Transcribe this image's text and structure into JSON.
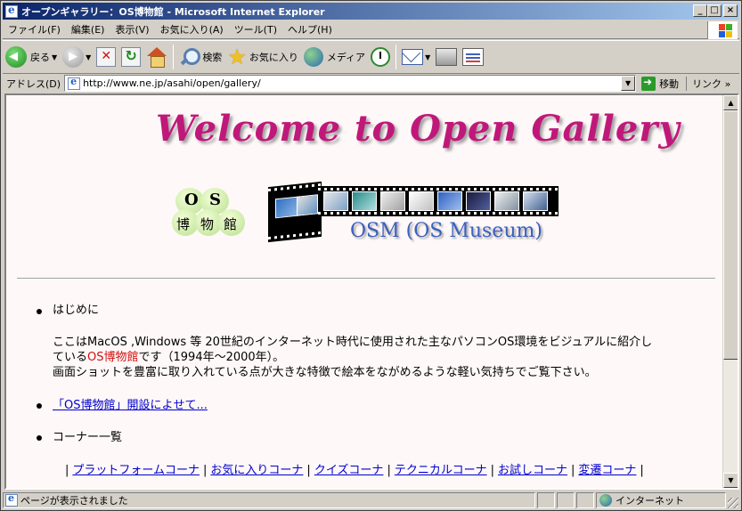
{
  "window": {
    "title": "オープンギャラリー：OS博物館 - Microsoft Internet Explorer",
    "min_label": "_",
    "max_label": "□",
    "close_label": "×"
  },
  "menubar": {
    "items": [
      "ファイル(F)",
      "編集(E)",
      "表示(V)",
      "お気に入り(A)",
      "ツール(T)",
      "ヘルプ(H)"
    ]
  },
  "toolbar": {
    "back_label": "戻る",
    "search_label": "検索",
    "favorites_label": "お気に入り",
    "media_label": "メディア"
  },
  "addressbar": {
    "label": "アドレス(D)",
    "url": "http://www.ne.jp/asahi/open/gallery/",
    "go_label": "移動",
    "links_label": "リンク",
    "links_more": "»"
  },
  "page": {
    "welcome": "Welcome to Open Gallery",
    "logo_os": [
      "O",
      "S"
    ],
    "logo_kanji": [
      "博",
      "物",
      "館"
    ],
    "osm_caption": "OSM (OS Museum)",
    "intro_heading": "はじめに",
    "intro_line1": "ここはMacOS ,Windows 等 20世紀のインターネット時代に使用された主なパソコンOS環境をビジュアルに紹介し",
    "intro_line2_pre": "ている",
    "intro_line2_red": "OS博物館",
    "intro_line2_post": "です（1994年～2000年）。",
    "intro_line3": "画面ショットを豊富に取り入れている点が大きな特徴で絵本をながめるような軽い気持ちでご覧下さい。",
    "opening_link": "「OS博物館」開設によせて...",
    "corners_heading": "コーナー一覧",
    "corners": [
      "プラットフォームコーナ",
      "お気に入りコーナ",
      "クイズコーナ",
      "テクニカルコーナ",
      "お試しコーナ",
      "変遷コーナ"
    ],
    "pipe": "|"
  },
  "statusbar": {
    "message": "ページが表示されました",
    "zone": "インターネット"
  },
  "colors": {
    "welcome": "#c0187a",
    "osm_text": "#3a5fbf",
    "highlight": "#d01010",
    "link": "#0000cc",
    "page_bg": "#fff8f8"
  }
}
